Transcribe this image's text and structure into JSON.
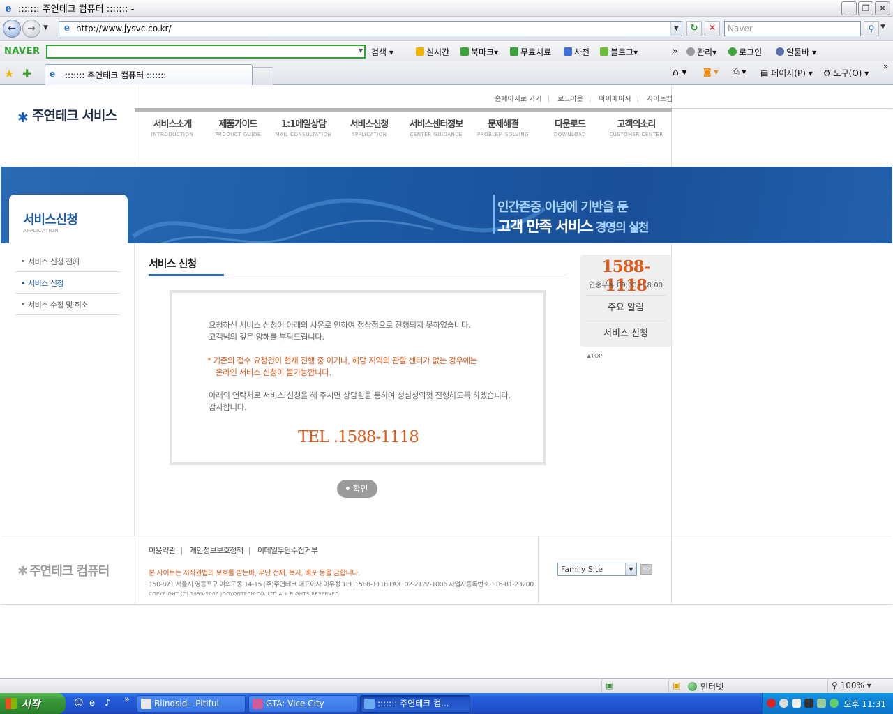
{
  "window": {
    "title": "::::::: 주연테크 컴퓨터 ::::::: -",
    "min": "_",
    "max": "❐",
    "close": "✕"
  },
  "address": {
    "url": "http://www.jysvc.co.kr/",
    "search_placeholder": "Naver"
  },
  "naver_toolbar": {
    "logo": "NAVER",
    "items": [
      "검색",
      "실시간",
      "북마크",
      "무료치료",
      "사전",
      "블로그",
      "관리",
      "로그인",
      "알툴바"
    ]
  },
  "tabs": {
    "active_title": "::::::: 주연테크 컴퓨터 :::::::",
    "commands": [
      "페이지(P)",
      "도구(O)"
    ]
  },
  "site": {
    "logo": "주연테크 서비스",
    "top_links": [
      "홈페이지로 가기",
      "로그아웃",
      "마이페이지",
      "사이트맵"
    ],
    "gnb": [
      {
        "ko": "서비스소개",
        "en": "INTRODUCTION"
      },
      {
        "ko": "제품가이드",
        "en": "PRODUCT GUIDE"
      },
      {
        "ko": "1:1메일상담",
        "en": "MAIL CONSULTATION"
      },
      {
        "ko": "서비스신청",
        "en": "APPLICATION"
      },
      {
        "ko": "서비스센터정보",
        "en": "CENTER GUIDANCE"
      },
      {
        "ko": "문제해결",
        "en": "PROBLEM SOLVING"
      },
      {
        "ko": "다운로드",
        "en": "DOWNLOAD"
      },
      {
        "ko": "고객의소리",
        "en": "CUSTOMER CENTER"
      }
    ],
    "banner": {
      "line1": "인간존중 이념에 기반을 둔",
      "line2_main": "고객 만족 서비스",
      "line2_sub": " 경영의 실천"
    },
    "section": {
      "title": "서비스신청",
      "en": "APPLICATION"
    },
    "lnb": [
      "서비스 신청 전에",
      "서비스 신청",
      "서비스 수정 및 취소"
    ],
    "content_title": "서비스 신청",
    "message": {
      "p1a": "요청하신 서비스 신청이 아래의 사유로 인하여 정상적으로 진행되지 못하였습니다.",
      "p1b": "고객님의 깊은 양해를 부탁드립니다.",
      "p2a": "* 기존의 접수 요청건이 현재 진행 중 이거나, 해당 지역의 관할 센터가 없는 경우에는",
      "p2b": "온라인 서비스 신청이 불가능합니다.",
      "p3a": "아래의 연락처로 서비스 신청을 해 주시면 상담원을 통하여 성심성의껏 진행하도록 하겠습니다.",
      "p3b": "감사합니다.",
      "tel": "TEL .1588-1118"
    },
    "ok_button": "확인",
    "callbox": {
      "number": "1588-1118",
      "hours": "연중무휴 09:00~18:00",
      "btn1": "주요 알림",
      "btn2": "서비스 신청"
    },
    "top_link": "▲TOP",
    "footer": {
      "logo": "주연테크 컴퓨터",
      "links": [
        "이용약관",
        "개인정보보호정책",
        "이메일무단수집거부"
      ],
      "notice": "본 사이트는 저작권법의 보호를 받는바, 무단 전재, 복사, 배포 등을 금합니다.",
      "address": "150-871 서울시 영등포구 여의도동 14-15 (주)주연테크  대표이사 이우정  TEL.1588-1118  FAX. 02-2122-1006  사업자등록번호 116-81-23200",
      "copyright": "COPYRIGHT (C) 1999-2006 JOOYONTECH CO.,LTD ALL RIGHTS RESERVED.",
      "family_site": "Family Site",
      "go": "GO"
    }
  },
  "statusbar": {
    "zone": "인터넷",
    "zoom": "100%"
  },
  "taskbar": {
    "start": "시작",
    "buttons": [
      "Blindsid - Pitiful",
      "GTA: Vice City",
      "::::::: 주연테크 컴..."
    ],
    "clock": "오후 11:31"
  }
}
